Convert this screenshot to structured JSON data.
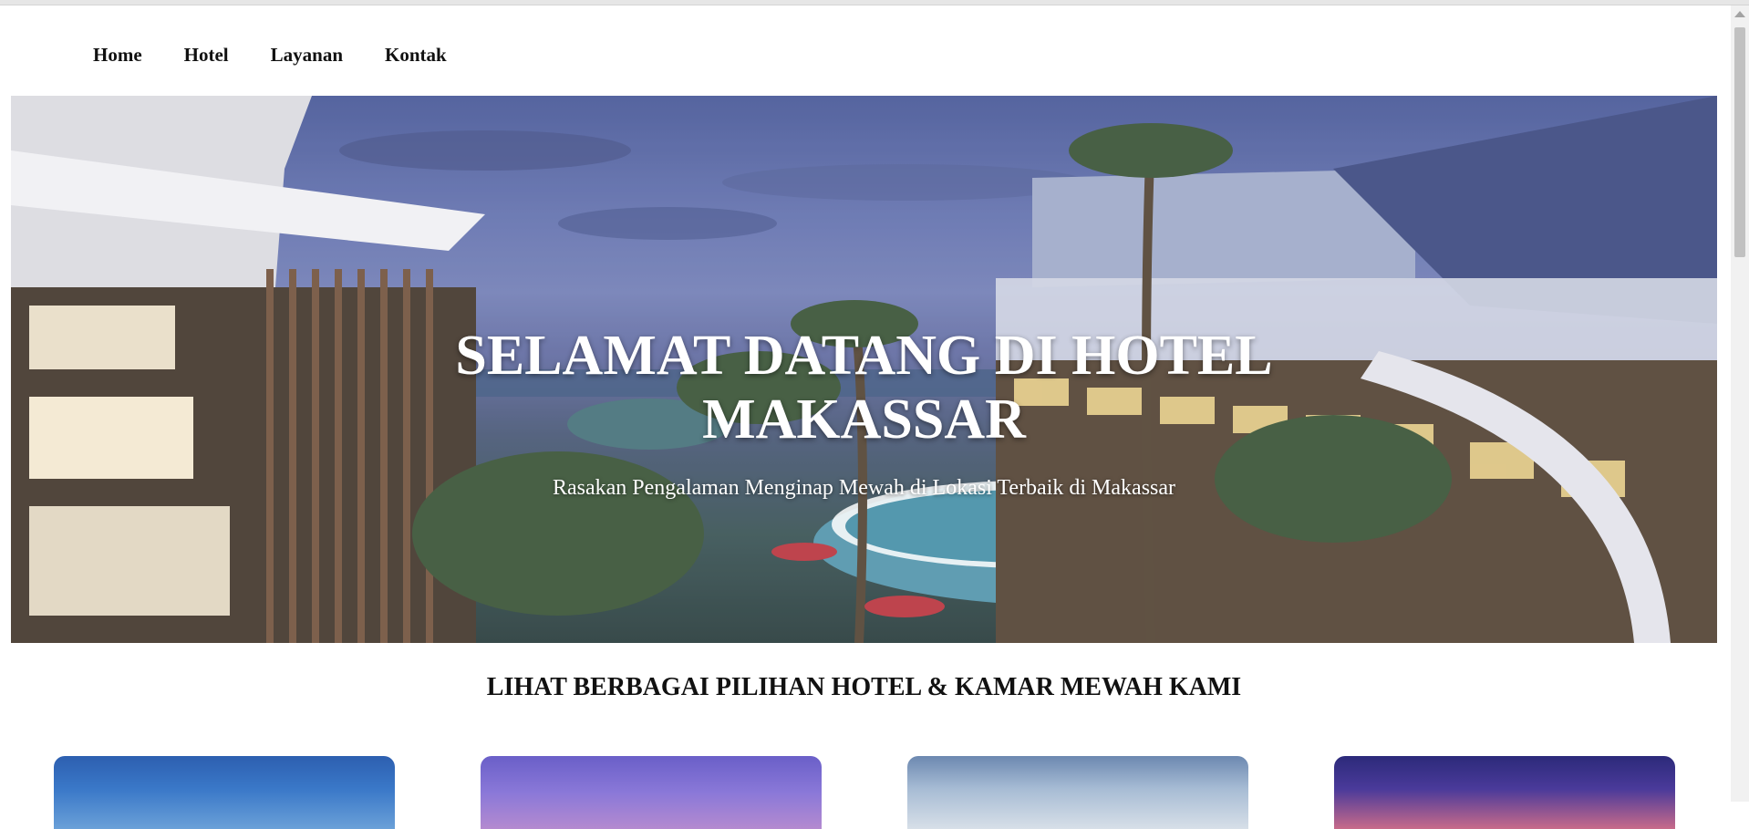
{
  "nav": {
    "items": [
      {
        "label": "Home"
      },
      {
        "label": "Hotel"
      },
      {
        "label": "Layanan"
      },
      {
        "label": "Kontak"
      }
    ]
  },
  "hero": {
    "title_line1": "SELAMAT DATANG DI HOTEL",
    "title_line2": "MAKASSAR",
    "subtitle": "Rasakan Pengalaman Menginap Mewah di Lokasi Terbaik di Makassar"
  },
  "section": {
    "title": "LIHAT BERBAGAI PILIHAN HOTEL & KAMAR MEWAH KAMI"
  },
  "cards": [
    {
      "image": "hotel-photo-1"
    },
    {
      "image": "hotel-photo-2"
    },
    {
      "image": "hotel-photo-3"
    },
    {
      "image": "hotel-photo-4"
    }
  ],
  "colors": {
    "text": "#111111",
    "hero_text": "#ffffff",
    "background": "#ffffff"
  }
}
